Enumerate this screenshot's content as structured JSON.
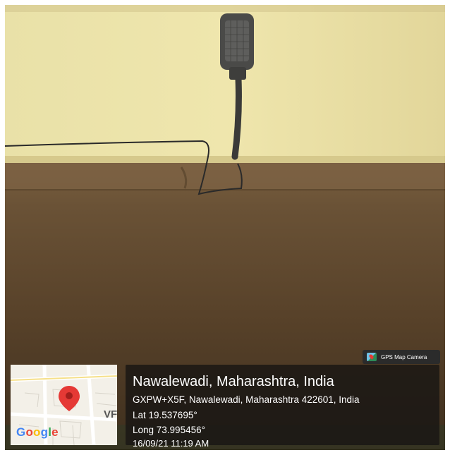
{
  "badge": {
    "label": "GPS Map Camera",
    "icon": "gps-map-camera-icon"
  },
  "map": {
    "logo_letters": [
      "G",
      "o",
      "o",
      "g",
      "l",
      "e"
    ],
    "label": "VF",
    "pin_icon": "map-pin-icon",
    "pin_color": "#e53935"
  },
  "location": {
    "title": "Nawalewadi, Maharashtra, India",
    "address": "GXPW+X5F, Nawalewadi, Maharashtra 422601, India",
    "lat": "Lat 19.537695°",
    "long": "Long 73.995456°",
    "timestamp": "16/09/21 11:19 AM"
  },
  "colors": {
    "wall": "#e8dc9c",
    "ceiling": "#5a442b",
    "panel": "#1a1614"
  }
}
